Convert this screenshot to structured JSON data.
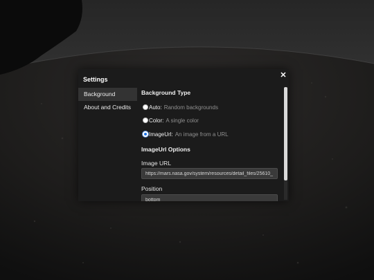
{
  "settings": {
    "title": "Settings",
    "close_glyph": "✕",
    "sidebar": [
      {
        "label": "Background",
        "active": true
      },
      {
        "label": "About and Credits",
        "active": false
      }
    ],
    "background_type": {
      "heading": "Background Type",
      "options": [
        {
          "label": "Auto:",
          "description": "Random backgrounds",
          "checked": false
        },
        {
          "label": "Color:",
          "description": "A single color",
          "checked": false
        },
        {
          "label": "ImageUrl:",
          "description": "An image from a URL",
          "checked": true
        }
      ]
    },
    "imageurl_options": {
      "heading": "ImageUrl Options",
      "image_url_label": "Image URL",
      "image_url_value": "https://mars.nasa.gov/system/resources/detail_files/25610_",
      "position_label": "Position",
      "position_value": "bottom"
    }
  }
}
